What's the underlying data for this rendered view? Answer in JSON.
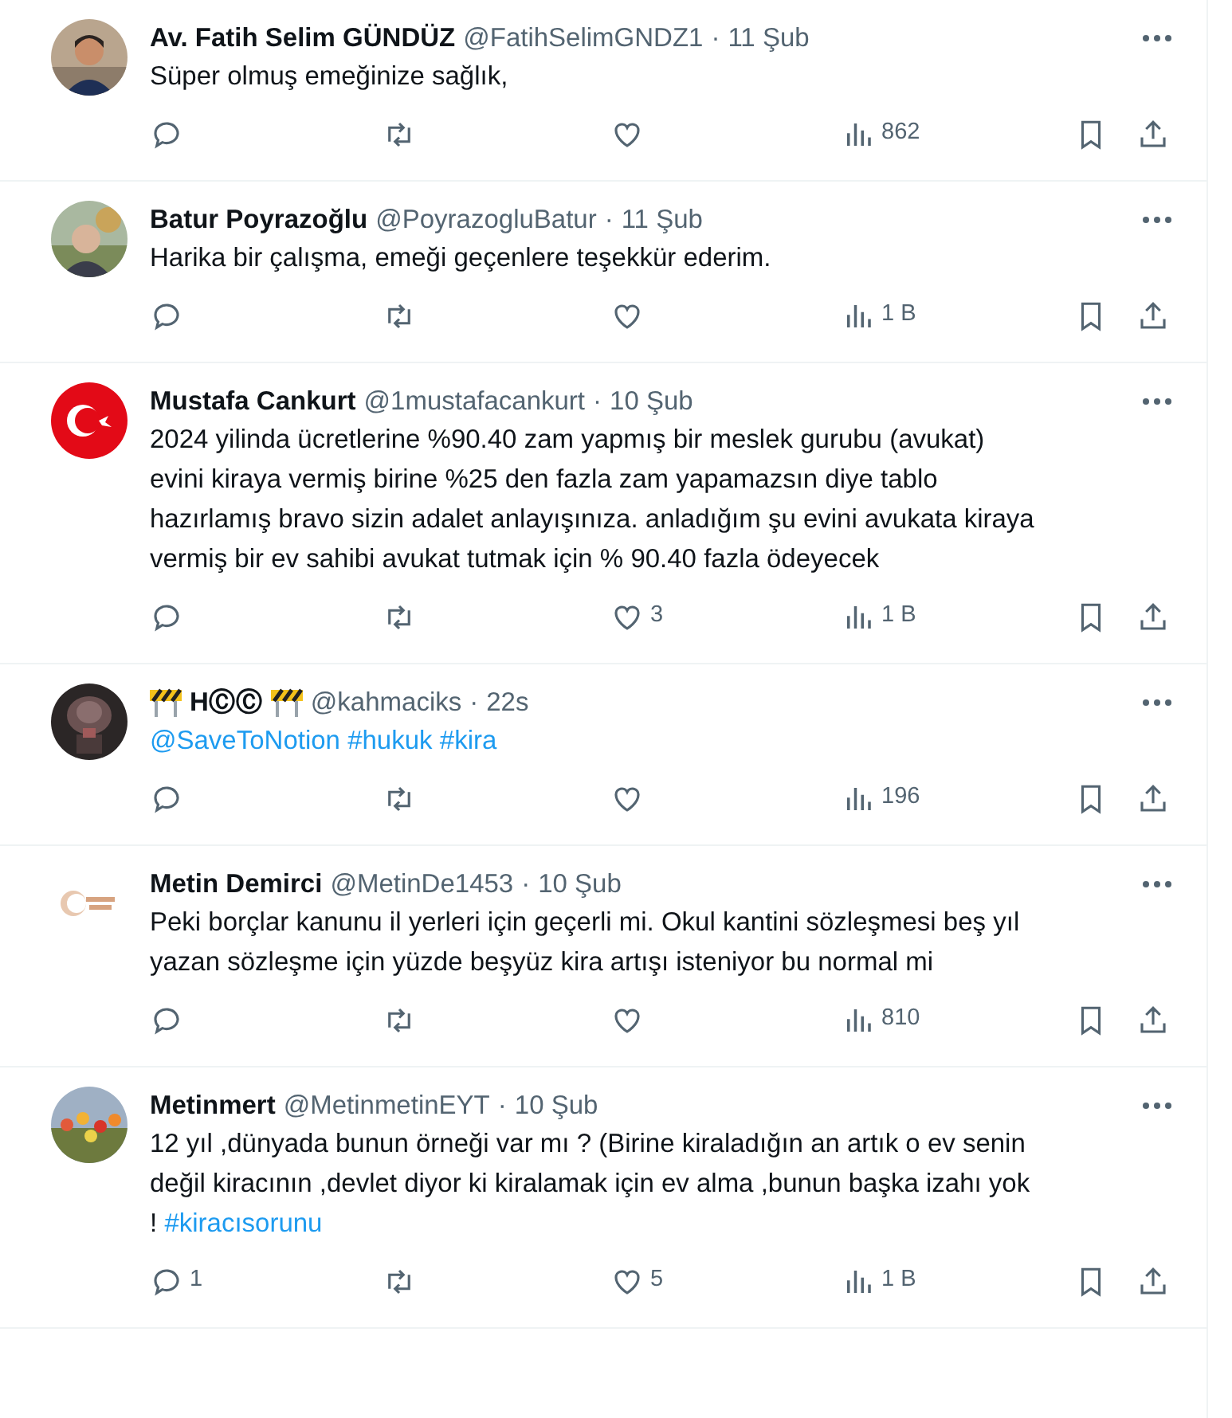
{
  "tweets": [
    {
      "avatar": {
        "kind": "picture"
      },
      "name": [
        {
          "kind": "text",
          "text": "Av. Fatih Selim GÜNDÜZ"
        }
      ],
      "handle": "@FatihSelimGNDZ1",
      "separator": "·",
      "date": "11 Şub",
      "body": [
        [
          {
            "kind": "text",
            "text": "Süper olmuş emeğinize sağlık,"
          }
        ]
      ],
      "views": "862"
    },
    {
      "avatar": {
        "kind": "picture"
      },
      "name": [
        {
          "kind": "text",
          "text": "Batur Poyrazoğlu"
        }
      ],
      "handle": "@PoyrazogluBatur",
      "separator": "·",
      "date": "11 Şub",
      "body": [
        [
          {
            "kind": "text",
            "text": "Harika bir çalışma, emeği geçenlere teşekkür ederim."
          }
        ]
      ],
      "views": "1 B"
    },
    {
      "avatar": {
        "kind": "picture"
      },
      "name": [
        {
          "kind": "text",
          "text": "Mustafa Cankurt"
        }
      ],
      "handle": "@1mustafacankurt",
      "separator": "·",
      "date": "10 Şub",
      "body": [
        [
          {
            "kind": "text",
            "text": "2024 yilinda ücretlerine %90.40 zam yapmış bir meslek gurubu (avukat)"
          }
        ],
        [
          {
            "kind": "text",
            "text": "evini kiraya vermiş birine %25 den fazla zam yapamazsın diye tablo"
          }
        ],
        [
          {
            "kind": "text",
            "text": "hazırlamış bravo sizin adalet anlayışınıza. anladığım şu evini avukata kiraya"
          }
        ],
        [
          {
            "kind": "text",
            "text": "vermiş bir ev sahibi avukat tutmak için  % 90.40 fazla ödeyecek"
          }
        ]
      ],
      "likes": "3",
      "views": "1 B"
    },
    {
      "avatar": {
        "kind": "picture"
      },
      "name": [
        {
          "kind": "barrier"
        },
        {
          "kind": "text",
          "text": "HⒸⒸ"
        },
        {
          "kind": "barrier"
        }
      ],
      "handle": "@kahmaciks",
      "separator": "·",
      "date": "22s",
      "body": [
        [
          {
            "kind": "link",
            "text": "@SaveToNotion"
          },
          {
            "kind": "link",
            "text": "#hukuk"
          },
          {
            "kind": "link",
            "text": "#kira"
          }
        ]
      ],
      "views": "196"
    },
    {
      "avatar": {
        "kind": "picture"
      },
      "name": [
        {
          "kind": "text",
          "text": "Metin Demirci"
        }
      ],
      "handle": "@MetinDe1453",
      "separator": "·",
      "date": "10 Şub",
      "body": [
        [
          {
            "kind": "text",
            "text": "Peki borçlar kanunu il yerleri için geçerli mi. Okul kantini sözleşmesi  beş yıl"
          }
        ],
        [
          {
            "kind": "text",
            "text": "yazan sözleşme için yüzde beşyüz kira artışı isteniyor bu normal mi"
          }
        ]
      ],
      "views": "810"
    },
    {
      "avatar": {
        "kind": "picture"
      },
      "name": [
        {
          "kind": "text",
          "text": "Metinmert"
        }
      ],
      "handle": "@MetinmetinEYT",
      "separator": "·",
      "date": "10 Şub",
      "body": [
        [
          {
            "kind": "text",
            "text": "12 yıl ,dünyada bunun örneği var mı ? (Birine kiraladığın an artık o ev senin"
          }
        ],
        [
          {
            "kind": "text",
            "text": "değil kiracının ,devlet diyor ki kiralamak için ev alma ,bunun başka izahı yok"
          }
        ],
        [
          {
            "kind": "text",
            "text": "!"
          },
          {
            "kind": "link",
            "text": "#kiracısorunu"
          }
        ]
      ],
      "replies": "1",
      "likes": "5",
      "views": "1 B"
    }
  ]
}
